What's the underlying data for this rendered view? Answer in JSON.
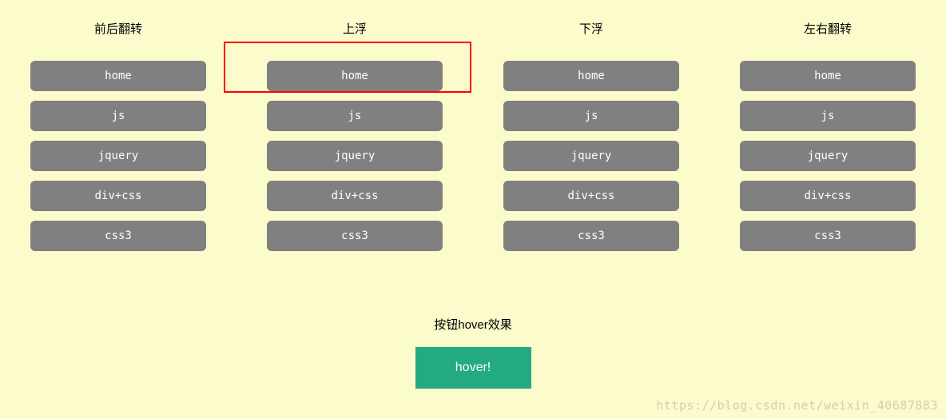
{
  "columns": [
    {
      "title": "前后翻转",
      "items": [
        "home",
        "js",
        "jquery",
        "div+css",
        "css3"
      ]
    },
    {
      "title": "上浮",
      "items": [
        "home",
        "js",
        "jquery",
        "div+css",
        "css3"
      ]
    },
    {
      "title": "下浮",
      "items": [
        "home",
        "js",
        "jquery",
        "div+css",
        "css3"
      ]
    },
    {
      "title": "左右翻转",
      "items": [
        "home",
        "js",
        "jquery",
        "div+css",
        "css3"
      ]
    }
  ],
  "bottom": {
    "title": "按钮hover效果",
    "button_label": "hover!"
  },
  "watermark": "https://blog.csdn.net/weixin_40687883"
}
